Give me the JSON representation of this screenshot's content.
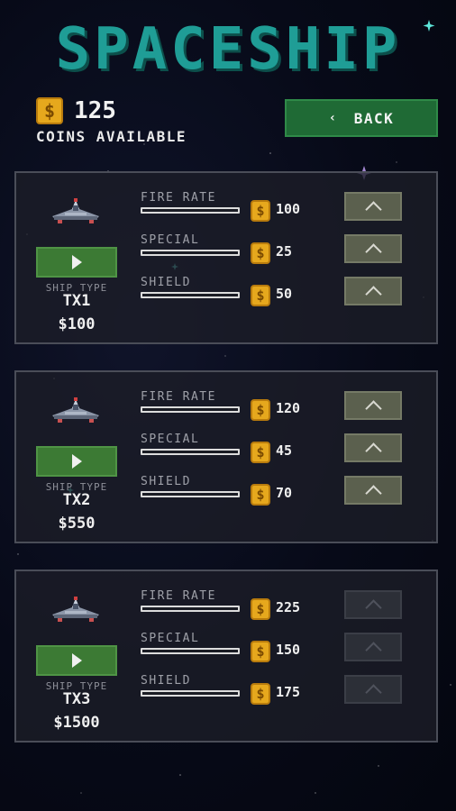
{
  "title": "SPACESHIP",
  "coins": {
    "amount": "125",
    "label": "COINS AVAILABLE",
    "icon": "coin-icon"
  },
  "back_button": {
    "label": "BACK",
    "icon": "chevron-left-icon"
  },
  "colors": {
    "title": "#1f9d96",
    "back_button": "#1f6a35",
    "play_button": "#3c7a34",
    "coin": "#e6a81d"
  },
  "ships": [
    {
      "type_label": "SHIP TYPE",
      "name": "TX1",
      "price": "$100",
      "upgrades_enabled": true,
      "stats": [
        {
          "label": "FIRE RATE",
          "price": "100"
        },
        {
          "label": "SPECIAL",
          "price": "25"
        },
        {
          "label": "SHIELD",
          "price": "50"
        }
      ]
    },
    {
      "type_label": "SHIP TYPE",
      "name": "TX2",
      "price": "$550",
      "upgrades_enabled": true,
      "stats": [
        {
          "label": "FIRE RATE",
          "price": "120"
        },
        {
          "label": "SPECIAL",
          "price": "45"
        },
        {
          "label": "SHIELD",
          "price": "70"
        }
      ]
    },
    {
      "type_label": "SHIP TYPE",
      "name": "TX3",
      "price": "$1500",
      "upgrades_enabled": false,
      "stats": [
        {
          "label": "FIRE RATE",
          "price": "225"
        },
        {
          "label": "SPECIAL",
          "price": "150"
        },
        {
          "label": "SHIELD",
          "price": "175"
        }
      ]
    }
  ]
}
